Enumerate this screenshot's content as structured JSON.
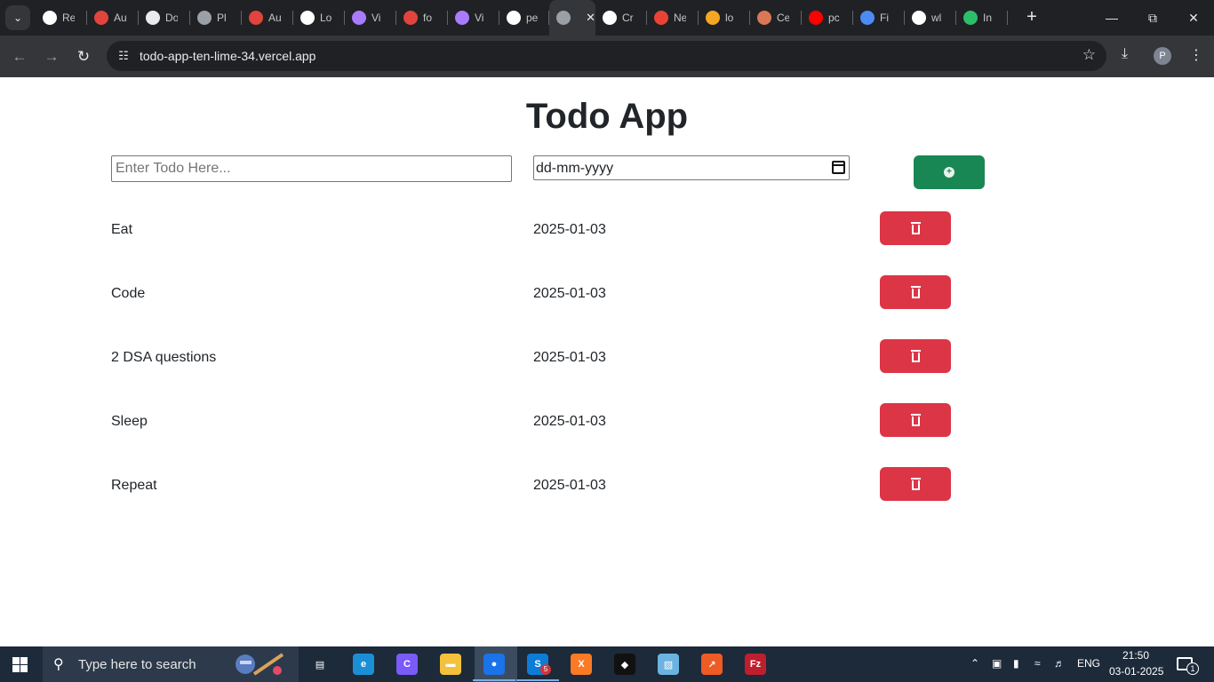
{
  "browser": {
    "tabs": [
      {
        "title": "Re",
        "icon": "chrome-icon",
        "color": "#ffffff"
      },
      {
        "title": "Au",
        "icon": "app-icon",
        "color": "#e0443d"
      },
      {
        "title": "Do",
        "icon": "download-icon",
        "color": "#e8eaed"
      },
      {
        "title": "Pl",
        "icon": "globe-icon",
        "color": "#9aa0a6"
      },
      {
        "title": "Au",
        "icon": "app-icon",
        "color": "#e0443d"
      },
      {
        "title": "Lo",
        "icon": "chatgpt-icon",
        "color": "#ffffff"
      },
      {
        "title": "Vi",
        "icon": "vite-icon",
        "color": "#a97bff"
      },
      {
        "title": "fo",
        "icon": "site-icon",
        "color": "#e0443d"
      },
      {
        "title": "Vi",
        "icon": "vite-icon",
        "color": "#a97bff"
      },
      {
        "title": "pe",
        "icon": "github-icon",
        "color": "#ffffff"
      },
      {
        "title": "",
        "icon": "globe-icon",
        "color": "#9aa0a6"
      },
      {
        "title": "Cr",
        "icon": "chatgpt-icon",
        "color": "#ffffff"
      },
      {
        "title": "Ne",
        "icon": "gmail-icon",
        "color": "#ea4335"
      },
      {
        "title": "lo",
        "icon": "site-icon",
        "color": "#f5a623"
      },
      {
        "title": "Ce",
        "icon": "claude-icon",
        "color": "#d97757"
      },
      {
        "title": "pc",
        "icon": "youtube-icon",
        "color": "#ff0000"
      },
      {
        "title": "Fi",
        "icon": "flag-icon",
        "color": "#4c8bf5"
      },
      {
        "title": "wl",
        "icon": "google-icon",
        "color": "#ffffff"
      },
      {
        "title": "In",
        "icon": "site-icon",
        "color": "#2bbf6a"
      }
    ],
    "active_tab_index": 10,
    "url": "todo-app-ten-lime-34.vercel.app",
    "profile_initial": "P"
  },
  "app": {
    "title": "Todo App",
    "input_placeholder": "Enter Todo Here...",
    "date_placeholder": "dd-mm-yyyy",
    "add_button_color": "#198754",
    "delete_button_color": "#dc3545",
    "todos": [
      {
        "name": "Eat",
        "date": "2025-01-03"
      },
      {
        "name": "Code",
        "date": "2025-01-03"
      },
      {
        "name": "2 DSA questions",
        "date": "2025-01-03"
      },
      {
        "name": "Sleep",
        "date": "2025-01-03"
      },
      {
        "name": "Repeat",
        "date": "2025-01-03"
      }
    ]
  },
  "taskbar": {
    "search_placeholder": "Type here to search",
    "pinned": [
      "task-view-icon",
      "edge-icon",
      "copilot-icon",
      "file-explorer-icon",
      "chrome-icon",
      "skype-icon",
      "xampp-icon",
      "app-icon",
      "notepad-icon",
      "postman-icon",
      "filezilla-icon"
    ],
    "language": "ENG",
    "time": "21:50",
    "date": "03-01-2025",
    "notification_count": "1",
    "skype_badge": "5"
  }
}
